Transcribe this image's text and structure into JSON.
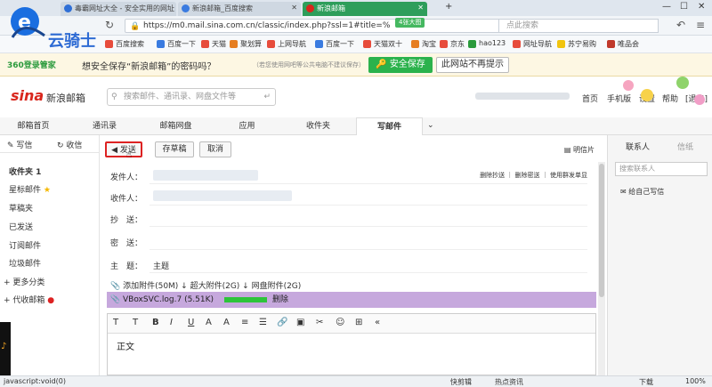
{
  "browser": {
    "tabs": [
      {
        "title": "毒霸网址大全 - 安全实用的网址",
        "color": "#2f6fd6",
        "active": false
      },
      {
        "title": "新浪邮箱_百度搜索",
        "color": "#3a7be0",
        "active": false
      },
      {
        "title": "新浪邮箱",
        "color": "#d9261c",
        "active": true
      }
    ],
    "url": "https://m0.mail.sina.com.cn/classic/index.php?ssl=1#title=%",
    "bigpic_label": "4张大图",
    "search_placeholder": "点此搜索",
    "bookmarks": [
      "网址大全",
      "百度搜索",
      "百度一下",
      "天猫",
      "聚划算",
      "上网导航",
      "百度一下",
      "天猫双十",
      "淘宝",
      "京东",
      "hao123",
      "网址导航",
      "苏宁易购",
      "唯品会"
    ]
  },
  "brand": {
    "name": "云骑士"
  },
  "notify": {
    "logo": "360登录管家",
    "text": "想安全保存“新浪邮箱”的密码吗？",
    "subtext": "（若您使用网吧等公共电脑不建议保存）",
    "save_label": "安全保存",
    "never_label": "此网站不再提示"
  },
  "mail": {
    "logo_text": "sina",
    "logo_sub": "新浪邮箱",
    "search_placeholder": "搜索邮件、通讯录、网盘文件等",
    "top_links": [
      "首页",
      "手机版",
      "设置",
      "帮助",
      "[退出]"
    ],
    "nav_tabs": [
      "邮箱首页",
      "通讯录",
      "邮箱网盘",
      "应用",
      "收件夹",
      "写邮件"
    ],
    "sidebar": {
      "write": "写信",
      "receive": "收信",
      "items": [
        "收件夹 1",
        "星标邮件",
        "草稿夹",
        "已发送",
        "订阅邮件",
        "垃圾邮件",
        "更多分类",
        "代收邮箱"
      ]
    },
    "compose": {
      "send": "发送",
      "draft": "存草稿",
      "cancel": "取消",
      "card": "明信片",
      "from_label": "发件人：",
      "to_label": "收件人：",
      "cc_label": "抄　送：",
      "bcc_label": "密　送：",
      "subject_label": "主　题：",
      "subject_value": "主题",
      "field_links": "删除抄送 ｜ 删除密送 ｜ 使用群发单显",
      "attach_bar": "添加附件(50M) ↓ 超大附件(2G) ↓ 网盘附件(2G)",
      "attachment": "VBoxSVC.log.7 (5.51K)",
      "attachment_delete": "删除",
      "body": "正文"
    },
    "right": {
      "tab1": "联系人",
      "tab2": "信纸",
      "search_placeholder": "搜索联系人",
      "note": "给自己写信"
    }
  },
  "status": {
    "left": "javascript:void(0)",
    "items": [
      "快剪辑",
      "热点资讯",
      "下载"
    ],
    "zoom": "100%"
  }
}
